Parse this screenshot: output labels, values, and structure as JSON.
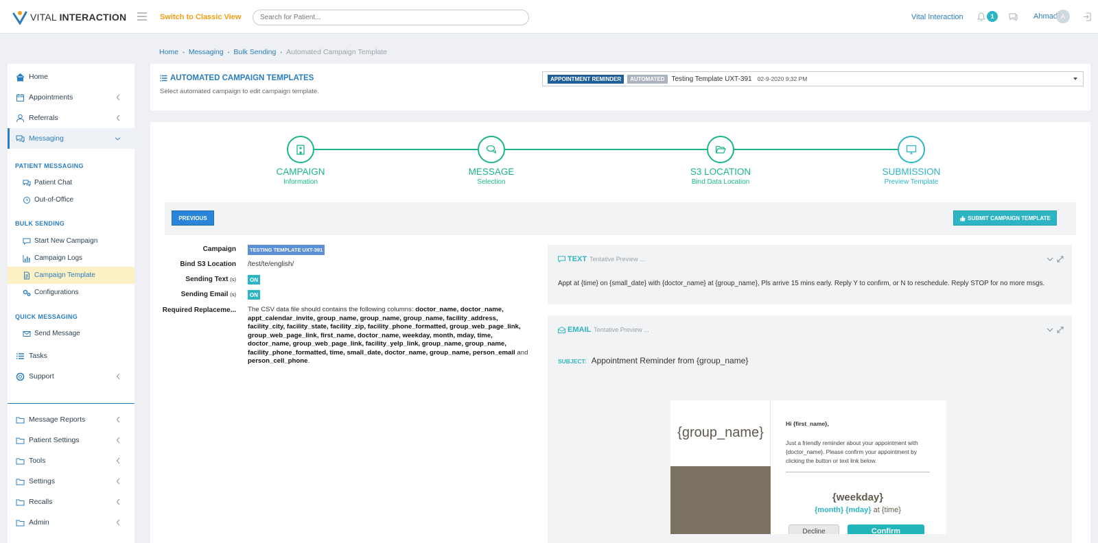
{
  "topbar": {
    "logo_text_light": "VITAL ",
    "logo_text_bold": "INTERACTION",
    "classic_view_link": "Switch to Classic View",
    "search_placeholder": "Search for Patient...",
    "org_link": "Vital Interaction",
    "notification_count": "1",
    "user_name": "Ahmad",
    "avatar_initial": "A"
  },
  "breadcrumb": {
    "items": [
      "Home",
      "Messaging",
      "Bulk Sending"
    ],
    "current": "Automated Campaign Template"
  },
  "sidebar": {
    "home": "Home",
    "appointments": "Appointments",
    "referrals": "Referrals",
    "messaging": "Messaging",
    "section_patient_messaging": "PATIENT MESSAGING",
    "patient_chat": "Patient Chat",
    "out_of_office": "Out-of-Office",
    "section_bulk_sending": "BULK SENDING",
    "start_new_campaign": "Start New Campaign",
    "campaign_logs": "Campaign Logs",
    "campaign_template": "Campaign Template",
    "configurations": "Configurations",
    "section_quick_messaging": "QUICK MESSAGING",
    "send_message": "Send Message",
    "tasks": "Tasks",
    "support": "Support",
    "message_reports": "Message Reports",
    "patient_settings": "Patient Settings",
    "tools": "Tools",
    "settings": "Settings",
    "recalls": "Recalls",
    "admin": "Admin"
  },
  "header": {
    "title": "AUTOMATED CAMPAIGN TEMPLATES",
    "subtitle": "Select automated campaign to edit campaign template.",
    "badge_type": "APPOINTMENT REMINDER",
    "badge_mode": "AUTOMATED",
    "template_name": "Testing Template UXT-391",
    "template_date": "02-9-2020 9:32 PM"
  },
  "steps": [
    {
      "title": "CAMPAIGN",
      "sub": "Information"
    },
    {
      "title": "MESSAGE",
      "sub": "Selection"
    },
    {
      "title": "S3 LOCATION",
      "sub": "Bind Data Location"
    },
    {
      "title": "SUBMISSION",
      "sub": "Preview Template"
    }
  ],
  "actions": {
    "previous": "PREVIOUS",
    "submit": "SUBMIT CAMPAIGN TEMPLATE"
  },
  "form": {
    "campaign_label": "Campaign",
    "campaign_value": "TESTING TEMPLATE UXT-391",
    "s3_label": "Bind S3 Location",
    "s3_value": "/test/te/english/",
    "sending_text_label": "Sending Text",
    "sending_email_label": "Sending Email",
    "small_s": "(s)",
    "on": "ON",
    "required_label": "Required Replaceme...",
    "required_intro": "The CSV data file should contains the following columns: ",
    "required_columns": "doctor_name, doctor_name, appt_calendar_invite, group_name, group_name, group_name, facility_address, facility_city, facility_state, facility_zip, facility_phone_formatted, group_web_page_link, group_web_page_link, first_name, doctor_name, weekday, month, mday, time, doctor_name, group_web_page_link, facility_yelp_link, group_name, group_name, facility_phone_formatted, time, small_date, doctor_name, group_name, person_email",
    "required_and": " and ",
    "required_last": "person_cell_phone",
    "required_end": "."
  },
  "text_panel": {
    "title": "TEXT",
    "sub": "Tentative Preview ...",
    "message": "Appt at {time} on {small_date} with {doctor_name} at {group_name}, Pls arrive 15 mins early. Reply Y to confirm, or N to reschedule. Reply STOP for no more msgs."
  },
  "email_panel": {
    "title": "EMAIL",
    "sub": "Tentative Preview ...",
    "subject_label": "SUBJECT:",
    "subject": "Appointment Reminder from {group_name}",
    "group_name": "{group_name}",
    "greeting": "Hi {first_name},",
    "body": "Just a friendly reminder about your appointment with {doctor_name}. Please confirm your appointment by clicking the button or text link below.",
    "weekday": "{weekday}",
    "month_mday": "{month} {mday}",
    "at_time": " at {time}",
    "decline": "Decline",
    "confirm": "Confirm"
  },
  "colors": {
    "primary_blue": "#2a7dbf",
    "teal": "#2eb5c4",
    "green": "#1bb58b",
    "orange": "#f39c12"
  }
}
